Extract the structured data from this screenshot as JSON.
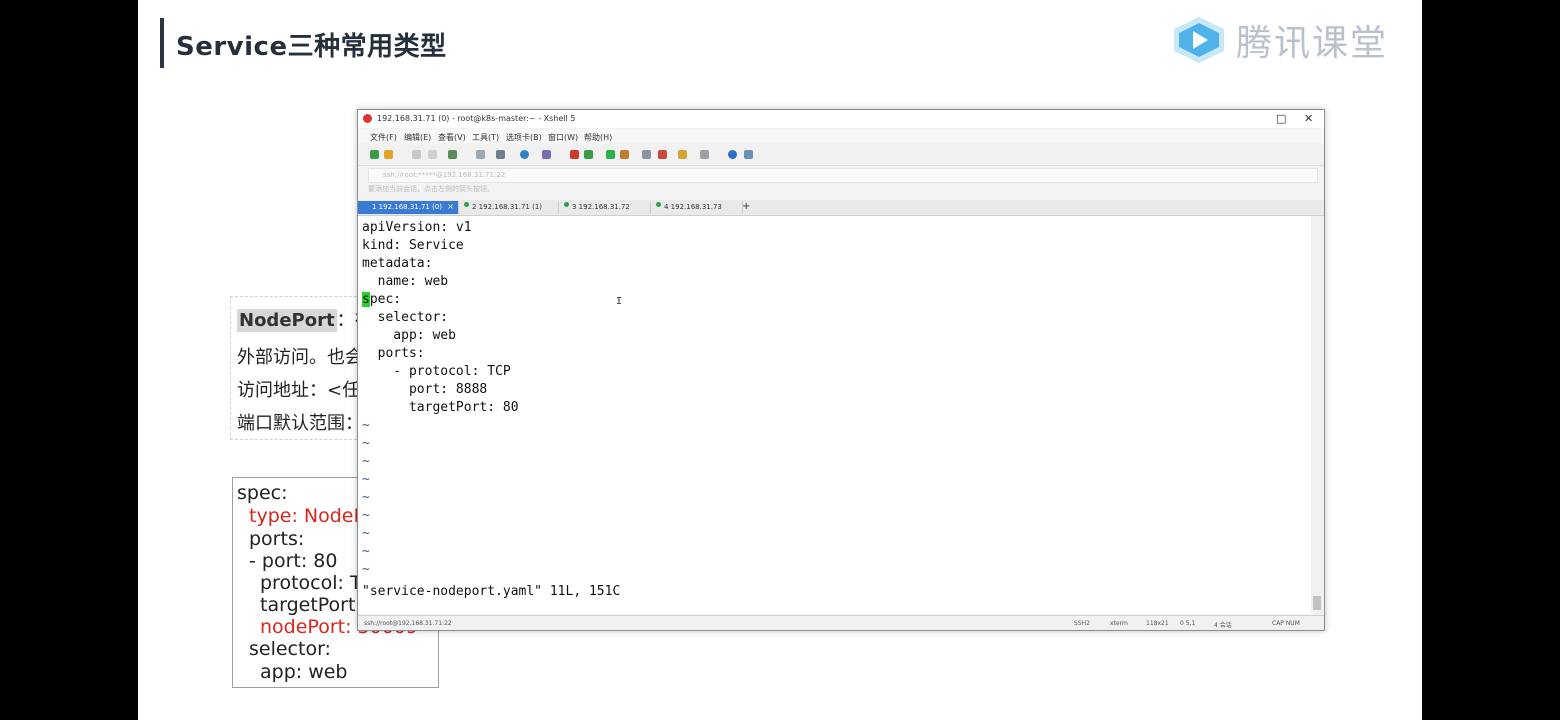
{
  "slide": {
    "title": "Service三种常用类型",
    "logo_text": "腾讯课堂"
  },
  "nodeport_text": {
    "line1_key": "NodePort",
    "line1_rest": "：在",
    "line2": "外部访问。也会",
    "line3": "访问地址：<任",
    "line4": "端口默认范围："
  },
  "code_box": {
    "lines": [
      "spec:",
      "type: NodeP",
      "ports:",
      "- port: 80",
      "protocol: T",
      "targetPort:",
      "nodePort: 30009",
      "selector:",
      "app: web"
    ]
  },
  "xshell": {
    "title": "192.168.31.71 (0) - root@k8s-master:~ - Xshell 5",
    "menu": [
      "文件(F)",
      "编辑(E)",
      "查看(V)",
      "工具(T)",
      "选项卡(B)",
      "窗口(W)",
      "帮助(H)"
    ],
    "address": "ssh://root:*****@192.168.31.71:22",
    "hint": "要添加当前会话，点击左侧的箭头按钮。",
    "tabs": [
      "1 192.168.31.71 (0)",
      "2 192.168.31.71 (1)",
      "3 192.168.31.72",
      "4 192.168.31.73"
    ],
    "terminal_lines": [
      "apiVersion: v1",
      "kind: Service",
      "metadata:",
      "  name: web",
      "pec:",
      "  selector:",
      "    app: web",
      "  ports:",
      "    - protocol: TCP",
      "      port: 8888",
      "      targetPort: 80"
    ],
    "cursor_char": "s",
    "tilde": "~",
    "file_status": "\"service-nodeport.yaml\" 11L, 151C",
    "status_bar": {
      "left": "ssh://root@192.168.31.71:22",
      "protocol": "SSH2",
      "term": "xterm",
      "size": "118x21",
      "pos": "0 5,1",
      "sessions": "4 会话",
      "num": "CAP NUM"
    }
  }
}
